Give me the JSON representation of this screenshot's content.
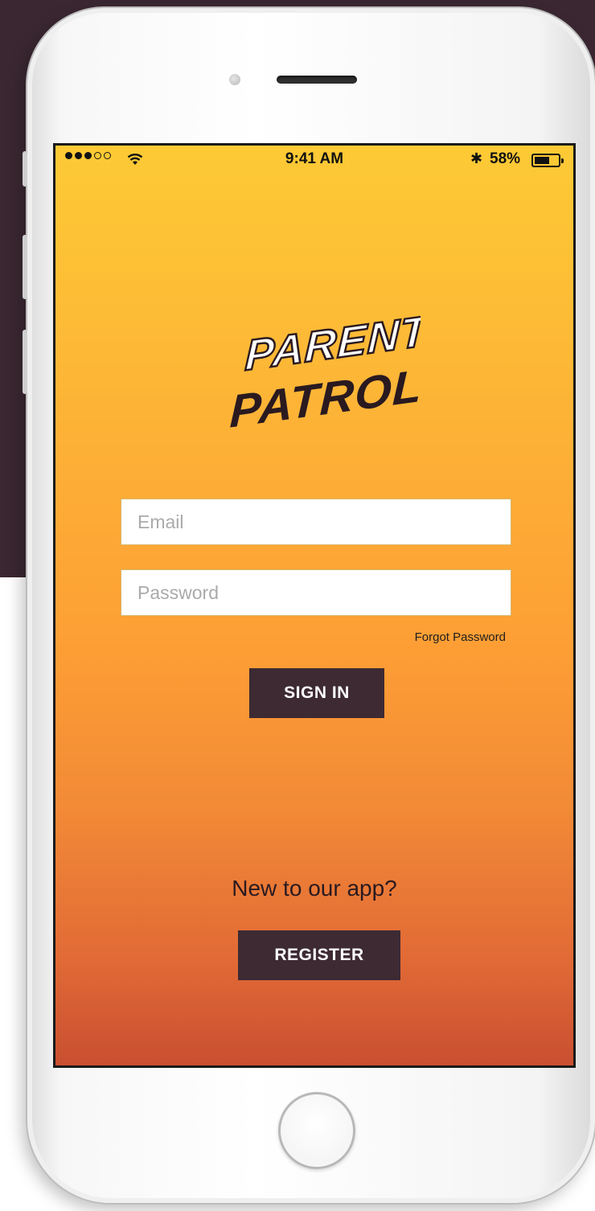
{
  "status_bar": {
    "time": "9:41 AM",
    "battery": "58%",
    "signal_icon": "signal-dots-icon",
    "wifi_icon": "wifi-icon",
    "bluetooth_icon": "bluetooth-icon",
    "bluetooth_glyph": "✱",
    "battery_level": 0.58
  },
  "logo": {
    "line1": "PARENT",
    "line2": "PATROL"
  },
  "form": {
    "email_placeholder": "Email",
    "password_placeholder": "Password",
    "forgot_password": "Forgot Password",
    "sign_in": "SIGN IN"
  },
  "register_section": {
    "prompt": "New to our app?",
    "register": "REGISTER"
  },
  "colors": {
    "accent_dark": "#3d2a33",
    "gradient_top": "#fdca35",
    "gradient_bottom": "#c94f31",
    "backdrop": "#3a2731"
  }
}
